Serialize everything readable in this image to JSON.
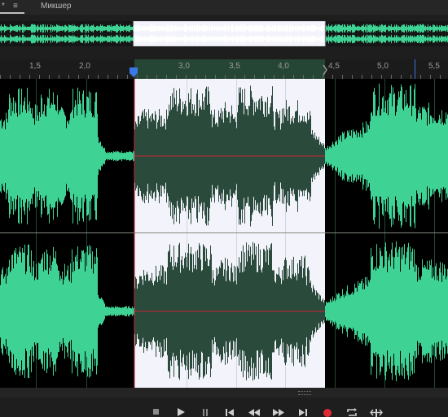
{
  "tabs": {
    "menu_glyph": "≡",
    "modified_glyph": "*",
    "mixer_label": "Микшер"
  },
  "ruler": {
    "ticks": [
      "1,5",
      "2,0",
      "3,0",
      "3,5",
      "4,0",
      "4,5",
      "5,0",
      "5,5"
    ],
    "visible_range": [
      1.2,
      5.7
    ],
    "selection_range": [
      2.5,
      4.42
    ]
  },
  "colors": {
    "waveform": "#3ed394",
    "selected_waveform": "#2a4a3b",
    "selection_background": "#f3f3fb",
    "selection_edge": "#c8283a",
    "record": "#e02a36"
  },
  "transport": {
    "buttons": [
      "stop-icon",
      "play-icon",
      "pause-icon",
      "go-to-start-icon",
      "rewind-icon",
      "fast-forward-icon",
      "go-to-end-icon",
      "record-icon",
      "loop-icon",
      "skip-selection-icon"
    ]
  }
}
